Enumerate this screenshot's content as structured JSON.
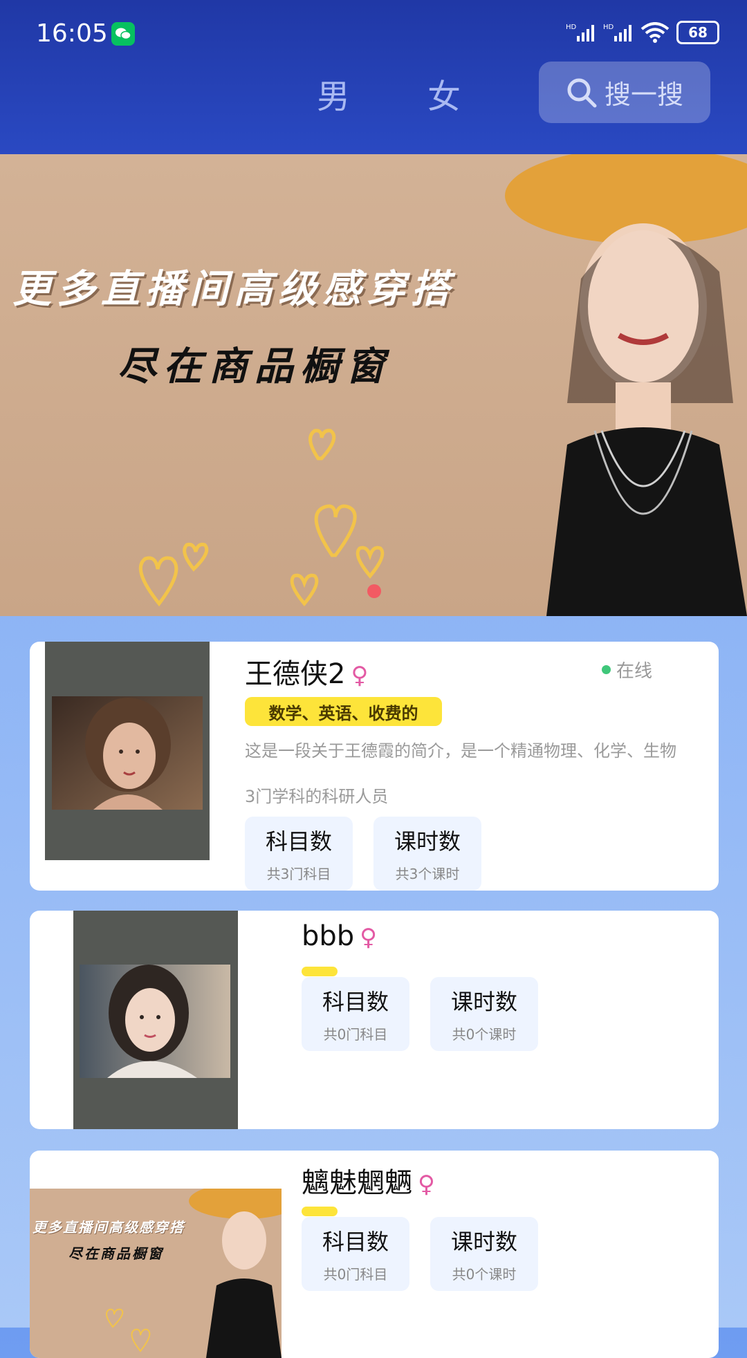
{
  "status_bar": {
    "time": "16:05",
    "battery": "68"
  },
  "header": {
    "tabs": [
      "男",
      "女"
    ],
    "search_placeholder": "搜一搜"
  },
  "banner": {
    "line1": "更多直播间高级感穿搭",
    "line2": "尽在商品橱窗"
  },
  "cards": [
    {
      "name": "王德侠2",
      "gender_symbol": "♀",
      "status": "在线",
      "tag": "数学、英语、收费的",
      "intro_line1": "这是一段关于王德霞的简介，是一个精通物理、化学、生物",
      "intro_line2": "3门学科的科研人员",
      "stat1_title": "科目数",
      "stat1_sub": "共3门科目",
      "stat2_title": "课时数",
      "stat2_sub": "共3个课时"
    },
    {
      "name": "bbb",
      "gender_symbol": "♀",
      "stat1_title": "科目数",
      "stat1_sub": "共0门科目",
      "stat2_title": "课时数",
      "stat2_sub": "共0个课时"
    },
    {
      "name": "魑魅魍魉",
      "gender_symbol": "♀",
      "thumb_line1": "更多直播间高级感穿搭",
      "thumb_line2": "尽在商品橱窗",
      "stat1_title": "科目数",
      "stat1_sub": "共0门科目",
      "stat2_title": "课时数",
      "stat2_sub": "共0个课时"
    }
  ],
  "colors": {
    "header": "#2038a6",
    "accent_tag": "#fde43a",
    "online": "#3fc77a",
    "female": "#e35aa4"
  }
}
